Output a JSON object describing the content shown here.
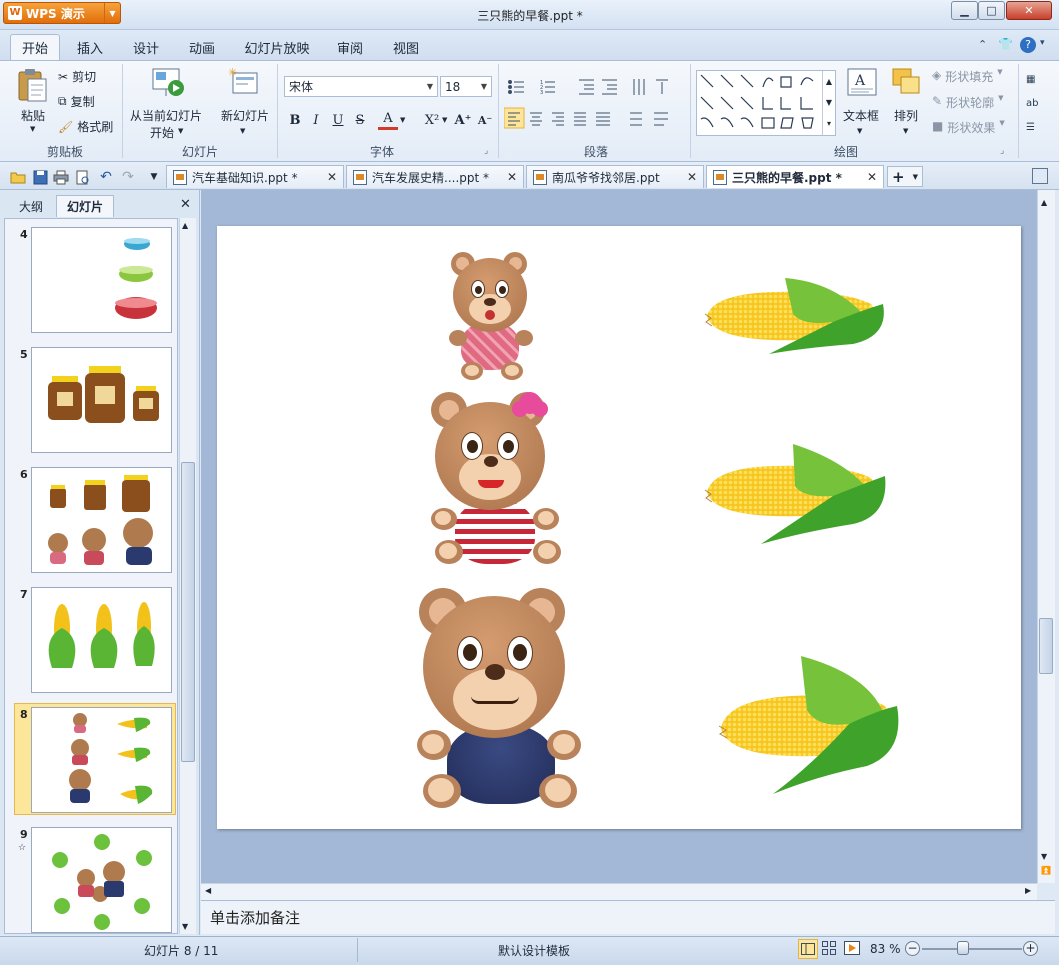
{
  "app": {
    "name": "WPS 演示",
    "doc_title": "三只熊的早餐.ppt *"
  },
  "ribbon_tabs": [
    "开始",
    "插入",
    "设计",
    "动画",
    "幻灯片放映",
    "审阅",
    "视图"
  ],
  "clipboard": {
    "paste": "粘贴",
    "cut": "剪切",
    "copy": "复制",
    "format_painter": "格式刷",
    "group": "剪贴板"
  },
  "slides_group": {
    "from_current": "从当前幻灯片",
    "start": "开始",
    "new_slide": "新幻灯片",
    "group": "幻灯片"
  },
  "font": {
    "name": "宋体",
    "size": "18",
    "bold": "B",
    "italic": "I",
    "underline": "U",
    "strike": "S",
    "color_a": "A",
    "superscript": "X²",
    "grow": "A⁺",
    "shrink": "A⁻",
    "group": "字体"
  },
  "paragraph": {
    "group": "段落"
  },
  "drawing": {
    "textbox": "文本框",
    "arrange": "排列",
    "shape_fill": "形状填充",
    "shape_outline": "形状轮廓",
    "shape_effects": "形状效果",
    "group": "绘图"
  },
  "doc_tabs": [
    {
      "label": "汽车基础知识.ppt *"
    },
    {
      "label": "汽车发展史精....ppt *"
    },
    {
      "label": "南瓜爷爷找邻居.ppt"
    },
    {
      "label": "三只熊的早餐.ppt *"
    }
  ],
  "left_panel": {
    "tab_outline": "大纲",
    "tab_slides": "幻灯片"
  },
  "thumbnails": [
    {
      "num": "4"
    },
    {
      "num": "5"
    },
    {
      "num": "6"
    },
    {
      "num": "7"
    },
    {
      "num": "8"
    },
    {
      "num": "9"
    }
  ],
  "notes_placeholder": "单击添加备注",
  "status": {
    "slide_info": "幻灯片 8 / 11",
    "template": "默认设计模板",
    "zoom": "83 %"
  },
  "colors": {
    "accent": "#e8841a",
    "selection": "#fce69a",
    "frame": "#a9bdd6"
  }
}
